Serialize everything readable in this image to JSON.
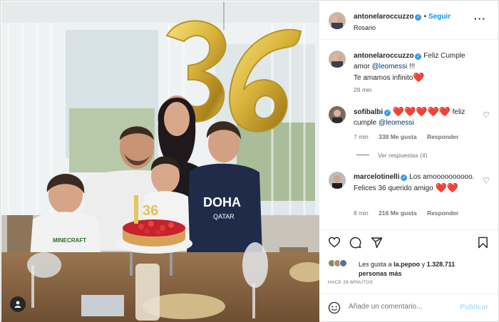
{
  "post": {
    "author": "antonelaroccuzzo",
    "follow_label": "Seguir",
    "location": "Rosario",
    "separator": "•",
    "more_icon": "more-horizontal-icon"
  },
  "photo": {
    "balloon_text": "36",
    "cake_candle_text": "36",
    "shirt_text_1": "DOHA",
    "shirt_text_2": "QATAR",
    "shirt_text_3": "MINECRAFT"
  },
  "caption": {
    "username": "antonelaroccuzzo",
    "text_1": "Feliz Cumple amor",
    "mention": "@leomessi",
    "text_2": "!!!",
    "text_3": "Te amamos infinito",
    "heart": "❤️",
    "time": "28 min"
  },
  "comments": [
    {
      "username": "sofibalbi",
      "hearts": "❤️❤️❤️❤️❤️",
      "text": "feliz cumple",
      "mention": "@leomessi",
      "time": "7 min",
      "likes": "338 Me gusta",
      "reply": "Responder",
      "view_replies": "Ver respuestas (4)"
    },
    {
      "username": "marcelotinelli",
      "text": "Los amoooooooooo. Felices 36 querido amigo",
      "hearts": "❤️❤️",
      "time": "8 min",
      "likes": "216 Me gusta",
      "reply": "Responder"
    }
  ],
  "likes": {
    "prefix": "Les gusta a",
    "user": "la.pepoo",
    "connector": "y",
    "count": "1.328.711",
    "suffix": "personas más"
  },
  "timestamp": "HACE 28 MINUTOS",
  "add_comment": {
    "placeholder": "Añade un comentario...",
    "publish": "Publicar"
  },
  "colors": {
    "accent": "#0095f6",
    "verified": "#3897f0",
    "heart": "#ed1c24",
    "balloon_gold": "#d9b43a"
  }
}
